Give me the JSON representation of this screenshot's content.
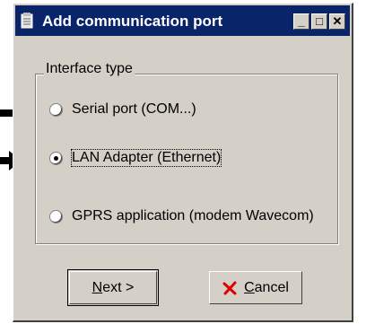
{
  "window": {
    "title": "Add communication port",
    "title_icon": "document-icon",
    "controls": {
      "minimize": "_",
      "maximize": "□",
      "close": "✕"
    }
  },
  "interface_group": {
    "label": "Interface type",
    "options": [
      {
        "label": "Serial port (COM...)",
        "selected": false
      },
      {
        "label": "LAN Adapter (Ethernet)",
        "selected": true
      },
      {
        "label": "GPRS application (modem Wavecom)",
        "selected": false
      }
    ]
  },
  "buttons": {
    "next_mnemonic": "N",
    "next_rest": "ext >",
    "cancel_mnemonic": "C",
    "cancel_rest": "ancel",
    "cancel_icon": "red-x-icon"
  },
  "annotations": {
    "arrow_icon": "arrow-right-icon"
  },
  "colors": {
    "titlebar": "#0a246a",
    "face": "#d4d0c8",
    "cancel_x": "#e00000"
  }
}
